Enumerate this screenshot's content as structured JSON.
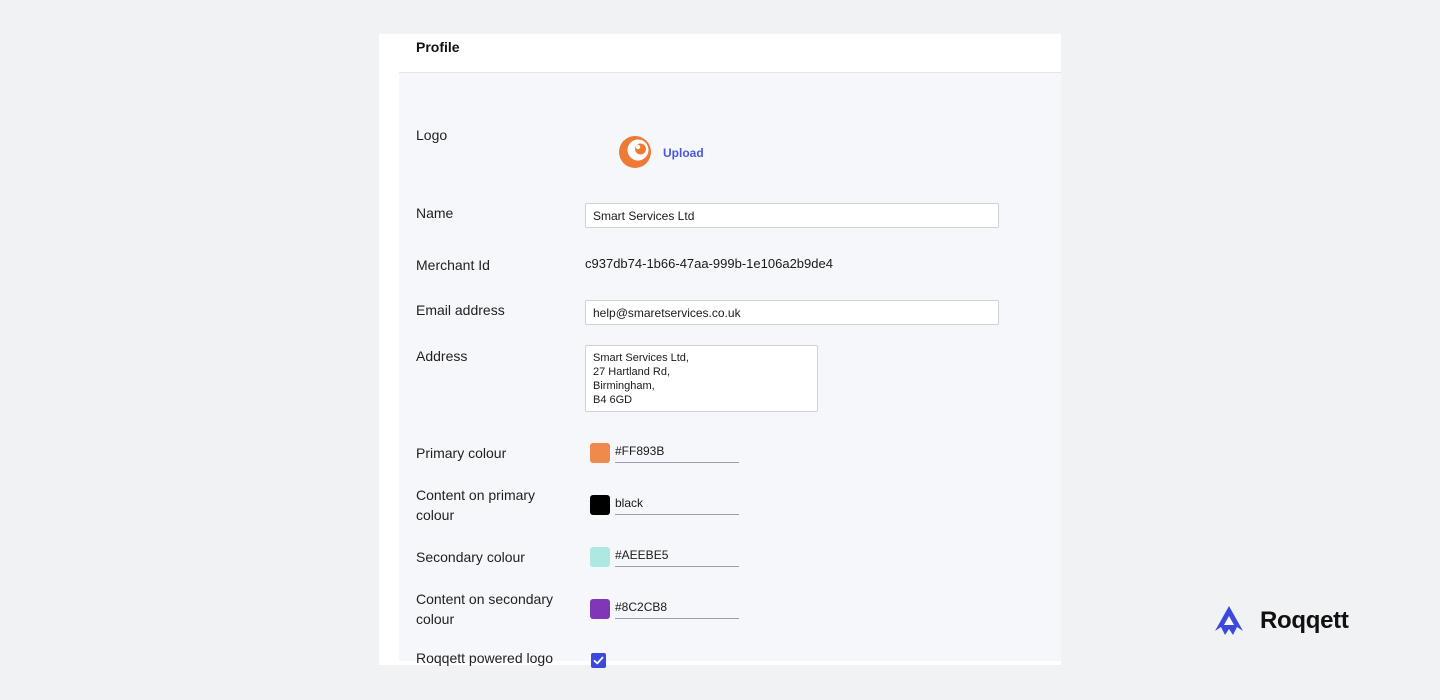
{
  "profile": {
    "title": "Profile",
    "logo_label": "Logo",
    "upload_label": "Upload",
    "name_label": "Name",
    "name_value": "Smart Services Ltd",
    "merchant_id_label": "Merchant Id",
    "merchant_id_value": "c937db74-1b66-47aa-999b-1e106a2b9de4",
    "email_label": "Email address",
    "email_value": "help@smaretservices.co.uk",
    "address_label": "Address",
    "address_lines": [
      "Smart Services Ltd,",
      "27 Hartland Rd,",
      "Birmingham,",
      "B4 6GD"
    ],
    "colours": [
      {
        "label": "Primary colour",
        "value": "#FF893B",
        "swatch": "#ef8a4c"
      },
      {
        "label": "Content on primary colour",
        "value": "black",
        "swatch": "#000000"
      },
      {
        "label": "Secondary colour",
        "value": "#AEEBE5",
        "swatch": "#aee8e2"
      },
      {
        "label": "Content on secondary colour",
        "value": "#8C2CB8",
        "swatch": "#7f37b8"
      }
    ],
    "powered_logo_label": "Roqqett powered logo",
    "powered_logo_checked": true
  },
  "logo_icon": "orange-crescent-logo",
  "brand": {
    "name": "Roqqett",
    "icon": "roqqett-rocket-icon",
    "accent": "#3b49df"
  },
  "colors": {
    "link": "#4a57d6",
    "checkbox": "#3b49df"
  }
}
